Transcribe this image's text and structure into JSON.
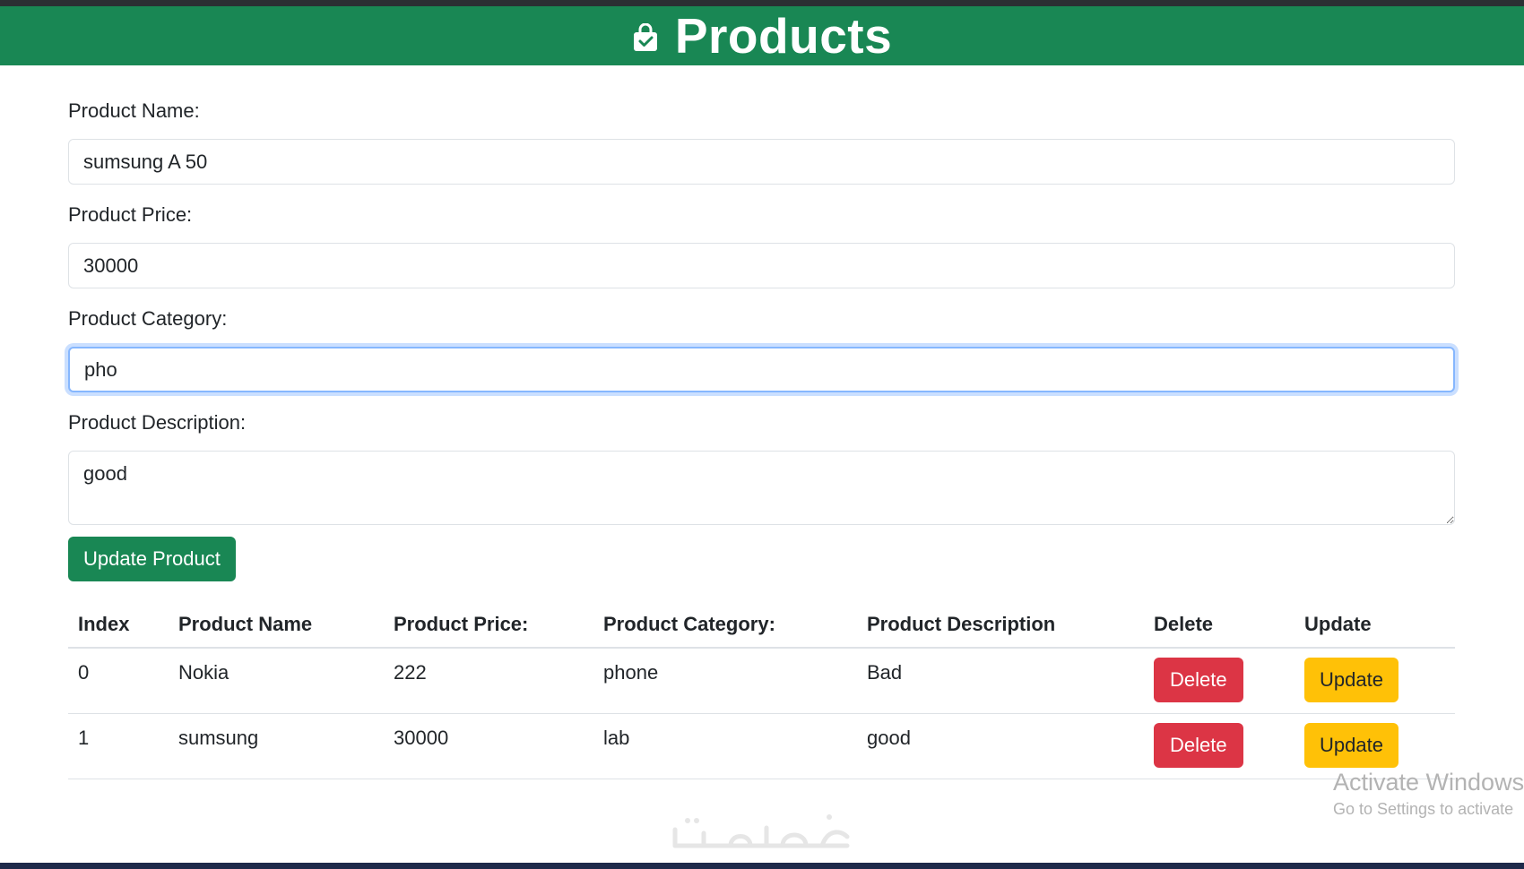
{
  "header": {
    "title": "Products",
    "icon": "shopping-bag-check-icon",
    "color": "#198754"
  },
  "form": {
    "name_label": "Product Name:",
    "name_value": "sumsung A 50",
    "price_label": "Product Price:",
    "price_value": "30000",
    "category_label": "Product Category:",
    "category_value": "pho",
    "description_label": "Product Description:",
    "description_value": "good",
    "submit_label": "Update Product"
  },
  "table": {
    "headers": [
      "Index",
      "Product Name",
      "Product Price:",
      "Product Category:",
      "Product Description",
      "Delete",
      "Update"
    ],
    "rows": [
      {
        "index": "0",
        "name": "Nokia",
        "price": "222",
        "category": "phone",
        "description": "Bad",
        "delete_label": "Delete",
        "update_label": "Update"
      },
      {
        "index": "1",
        "name": "sumsung",
        "price": "30000",
        "category": "lab",
        "description": "good",
        "delete_label": "Delete",
        "update_label": "Update"
      }
    ]
  },
  "colors": {
    "success": "#198754",
    "danger": "#dc3545",
    "warning": "#ffc107",
    "focus": "#86b7fe"
  },
  "watermark": {
    "title": "Activate Windows",
    "subtitle": "Go to Settings to activate"
  },
  "brand_logo_text": "خمسات"
}
